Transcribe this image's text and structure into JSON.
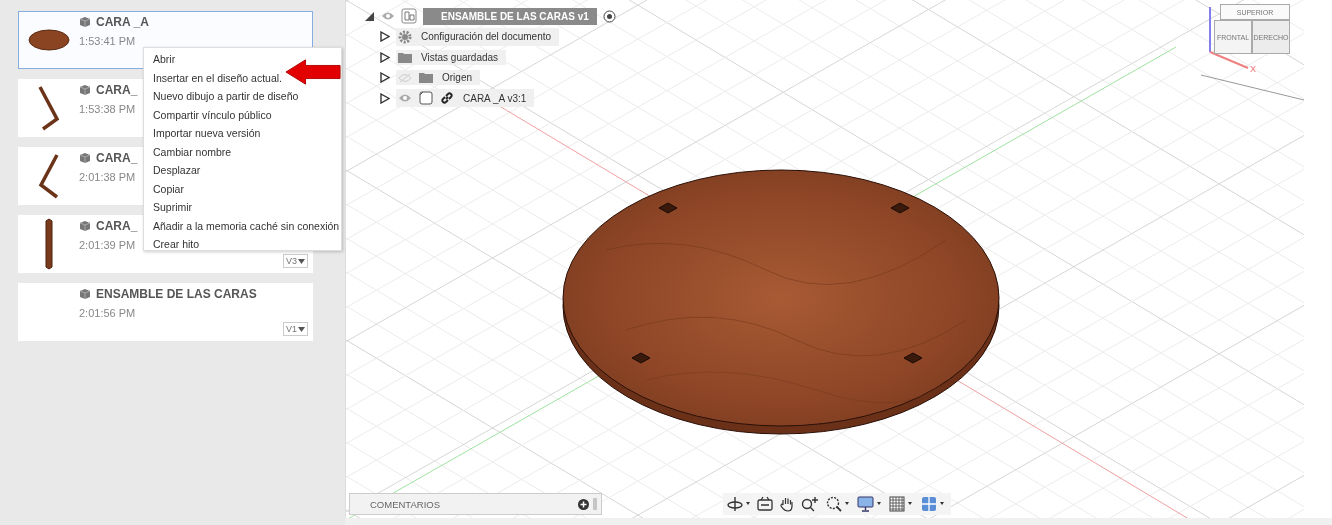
{
  "files": [
    {
      "name": "CARA _A",
      "time": "1:53:41 PM",
      "kind": "disc",
      "selected": true
    },
    {
      "name": "CARA_",
      "time": "1:53:38 PM",
      "kind": "bentright",
      "selected": false
    },
    {
      "name": "CARA_",
      "time": "2:01:38 PM",
      "kind": "bentleft",
      "selected": false
    },
    {
      "name": "CARA_",
      "time": "2:01:39 PM",
      "kind": "bar",
      "selected": false,
      "version": "V3"
    },
    {
      "name": "ENSAMBLE DE LAS CARAS",
      "time": "2:01:56 PM",
      "kind": "empty",
      "selected": false,
      "version": "V1"
    }
  ],
  "context_menu": [
    "Abrir",
    "Insertar en el diseño actual.",
    "Nuevo dibujo a partir de diseño",
    "Compartir vínculo público",
    "Importar nueva versión",
    "Cambiar nombre",
    "Desplazar",
    "Copiar",
    "Suprimir",
    "Añadir a la memoria caché sin conexión",
    "Crear hito"
  ],
  "browser": {
    "root": {
      "label": "ENSAMBLE DE LAS CARAS v1",
      "expanded": true,
      "visible": true
    },
    "children": [
      {
        "label": "Configuración del documento",
        "kind": "settings",
        "expanded": false,
        "linked": false
      },
      {
        "label": "Vistas guardadas",
        "kind": "folder",
        "expanded": false,
        "linked": false
      },
      {
        "label": "Origen",
        "kind": "folder",
        "visible": false,
        "expanded": false,
        "linked": false
      },
      {
        "label": "CARA _A v3:1",
        "kind": "component",
        "visible": true,
        "expanded": false,
        "linked": true
      }
    ]
  },
  "view_cube": {
    "top": "SUPERIOR",
    "front": "FRONTAL",
    "right": "DERECHO",
    "axis": "X"
  },
  "comments": {
    "label": "COMENTARIOS"
  }
}
